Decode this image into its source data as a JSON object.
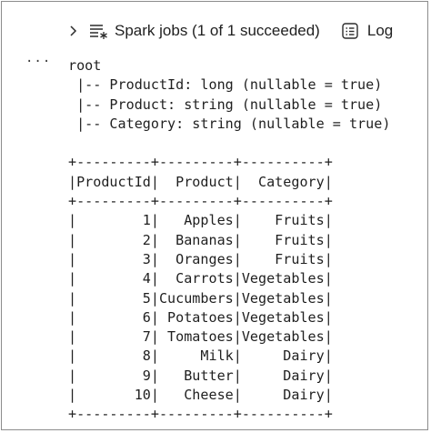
{
  "toolbar": {
    "spark_jobs_label": "Spark jobs (1 of 1 succeeded)",
    "log_label": "Log",
    "icons": {
      "expand": "chevron-right-icon",
      "spark": "spark-jobs-icon",
      "log": "log-icon"
    }
  },
  "more_label": "···",
  "output": {
    "lines": [
      "root",
      " |-- ProductId: long (nullable = true)",
      " |-- Product: string (nullable = true)",
      " |-- Category: string (nullable = true)",
      "",
      "+---------+---------+----------+",
      "|ProductId|  Product|  Category|",
      "+---------+---------+----------+",
      "|        1|   Apples|    Fruits|",
      "|        2|  Bananas|    Fruits|",
      "|        3|  Oranges|    Fruits|",
      "|        4|  Carrots|Vegetables|",
      "|        5|Cucumbers|Vegetables|",
      "|        6| Potatoes|Vegetables|",
      "|        7| Tomatoes|Vegetables|",
      "|        8|     Milk|     Dairy|",
      "|        9|   Butter|     Dairy|",
      "|       10|   Cheese|     Dairy|",
      "+---------+---------+----------+"
    ]
  },
  "colors": {
    "text": "#1f1f1f",
    "border": "#8c8c8c",
    "background": "#ffffff"
  }
}
